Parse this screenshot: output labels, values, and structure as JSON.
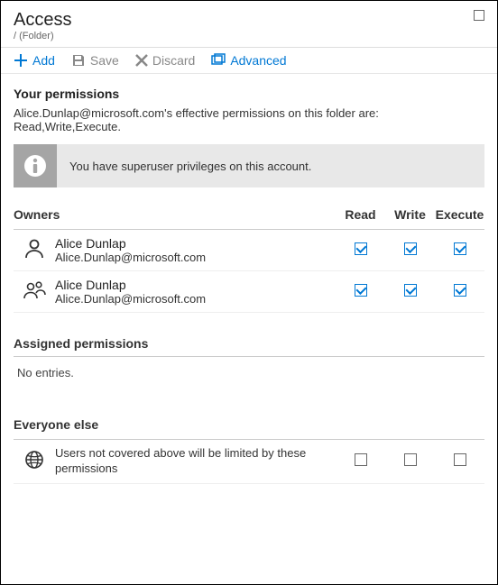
{
  "header": {
    "title": "Access",
    "breadcrumb": "/ (Folder)"
  },
  "toolbar": {
    "add": "Add",
    "save": "Save",
    "discard": "Discard",
    "advanced": "Advanced"
  },
  "permissions": {
    "title": "Your permissions",
    "description": "Alice.Dunlap@microsoft.com's effective permissions on this folder are: Read,Write,Execute.",
    "banner": "You have superuser privileges on this account."
  },
  "owners": {
    "title": "Owners",
    "cols": {
      "read": "Read",
      "write": "Write",
      "execute": "Execute"
    },
    "rows": [
      {
        "name": "Alice Dunlap",
        "email": "Alice.Dunlap@microsoft.com",
        "read": true,
        "write": true,
        "execute": true,
        "iconType": "person"
      },
      {
        "name": "Alice Dunlap",
        "email": "Alice.Dunlap@microsoft.com",
        "read": true,
        "write": true,
        "execute": true,
        "iconType": "group"
      }
    ]
  },
  "assigned": {
    "title": "Assigned permissions",
    "empty": "No entries."
  },
  "everyone": {
    "title": "Everyone else",
    "message": "Users not covered above will be limited by these permissions",
    "read": false,
    "write": false,
    "execute": false
  }
}
